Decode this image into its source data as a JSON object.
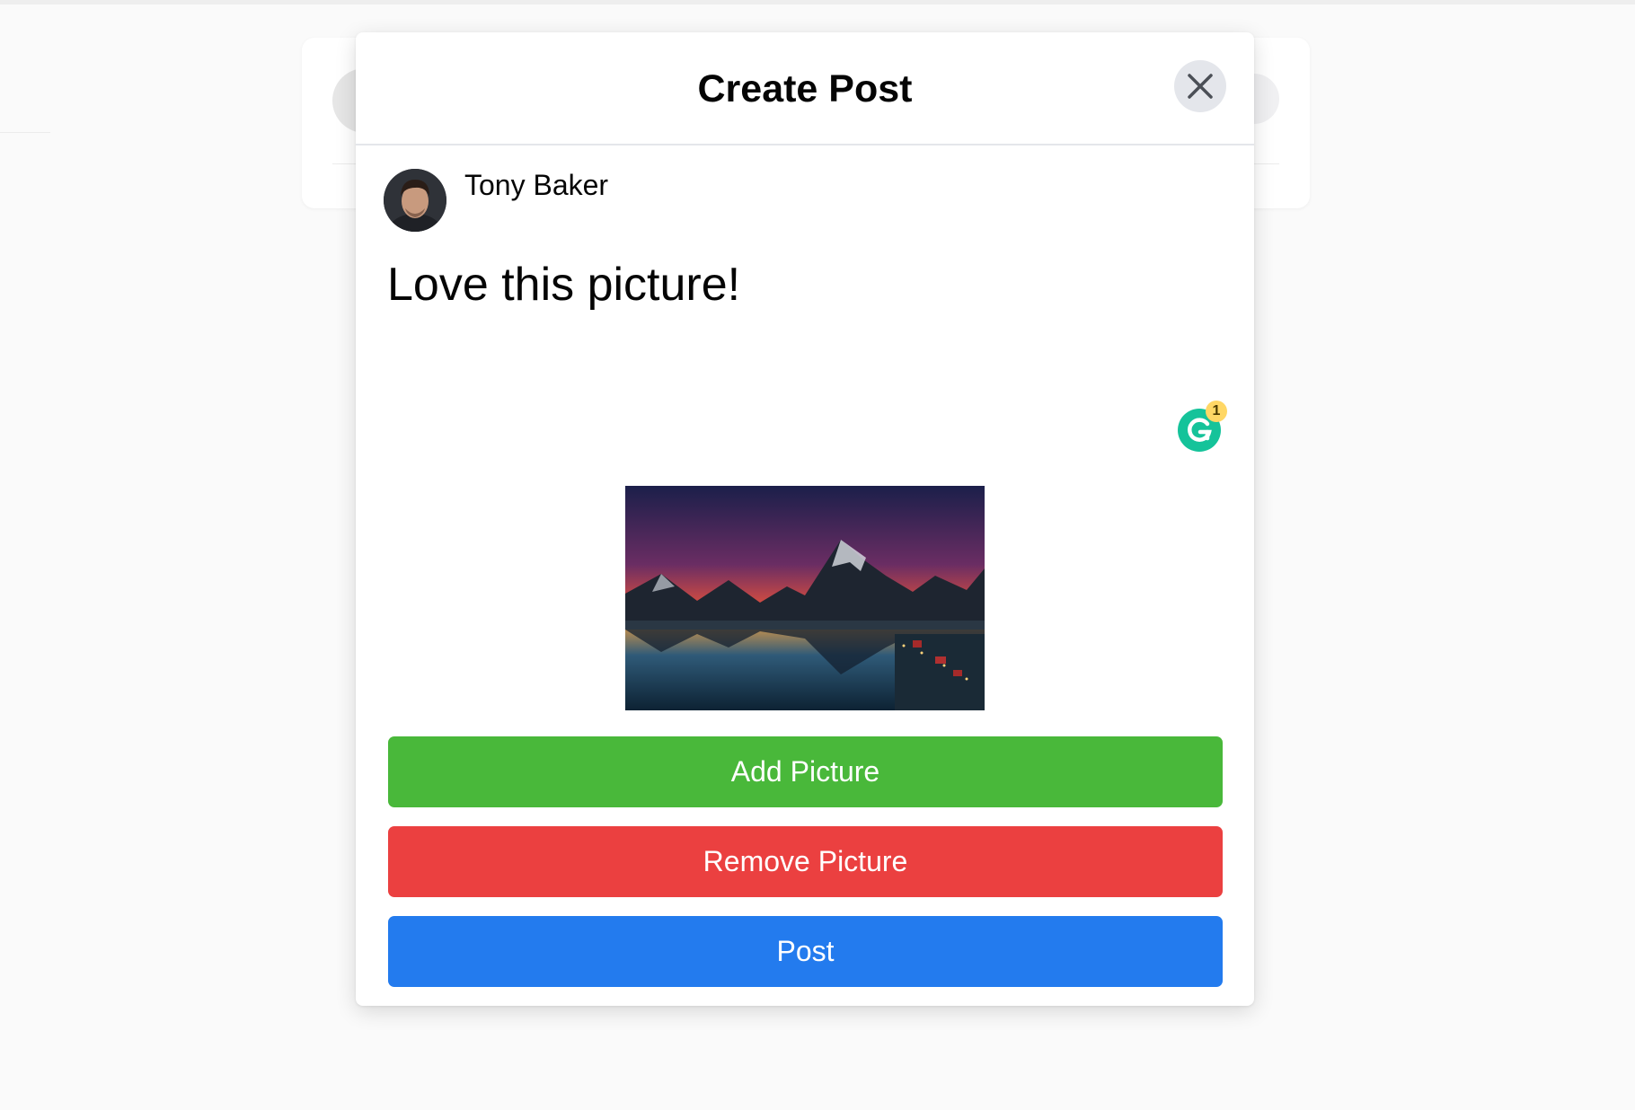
{
  "modal": {
    "title": "Create Post",
    "close_icon": "close-icon"
  },
  "user": {
    "name": "Tony Baker",
    "avatar_icon": "user-avatar"
  },
  "composer": {
    "text": "Love this picture!",
    "grammarly_count": "1"
  },
  "attachment": {
    "image_subject": "mountain-lake-sunset"
  },
  "buttons": {
    "add_picture": "Add Picture",
    "remove_picture": "Remove Picture",
    "post": "Post"
  },
  "colors": {
    "add_picture": "#49b83a",
    "remove_picture": "#eb4040",
    "post": "#237bee",
    "grammarly": "#15c39a"
  }
}
